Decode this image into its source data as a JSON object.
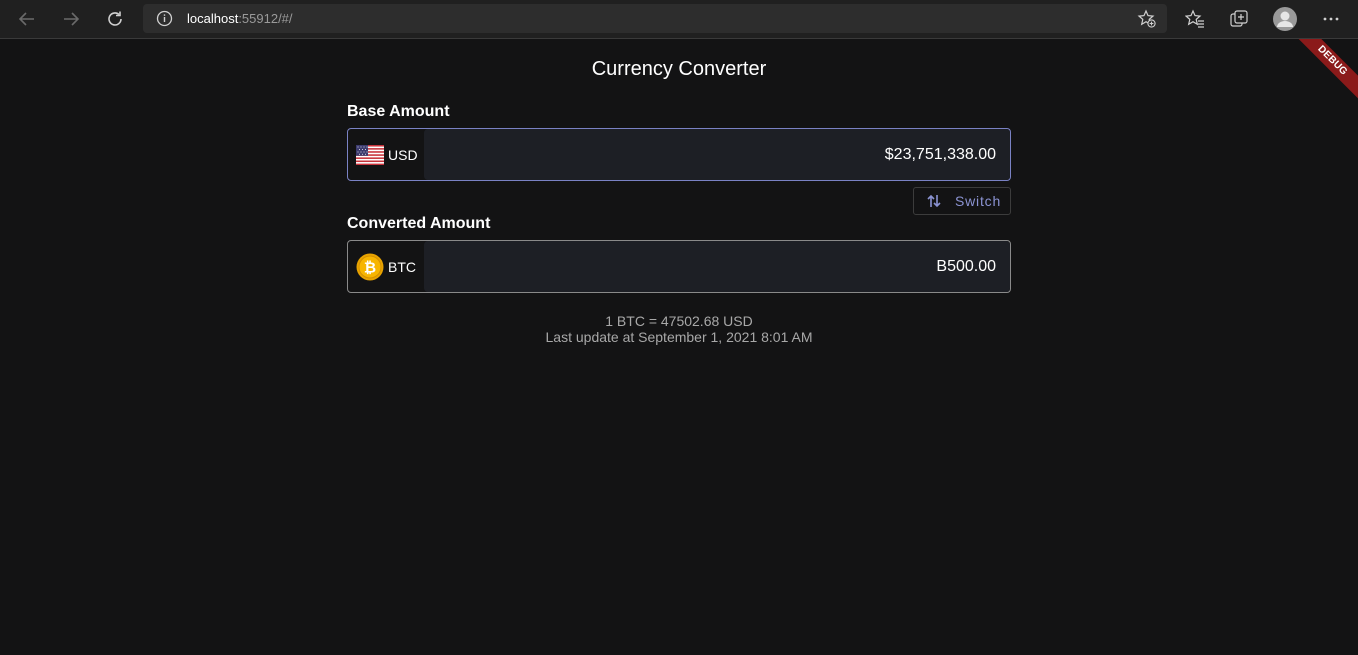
{
  "browser": {
    "url_host": "localhost",
    "url_rest": ":55912/#/"
  },
  "app": {
    "debug_label": "DEBUG",
    "title": "Currency Converter",
    "base": {
      "label": "Base Amount",
      "currency_code": "USD",
      "amount": "$23,751,338.00"
    },
    "switch_label": "Switch",
    "converted": {
      "label": "Converted Amount",
      "currency_code": "BTC",
      "amount": "B500.00"
    },
    "rate_line": "1 BTC = 47502.68 USD",
    "update_line": "Last update at September 1, 2021 8:01 AM"
  },
  "colors": {
    "background": "#131314",
    "accent": "#7a82c4",
    "field_fill": "#1d1f25",
    "debug_banner": "#8b1a1a"
  },
  "icons": {
    "back": "arrow-left-icon",
    "forward": "arrow-right-icon",
    "refresh": "refresh-icon",
    "site_info": "info-icon",
    "add_favorite": "star-add-icon",
    "favorites": "favorites-icon",
    "collections": "collections-icon",
    "profile": "profile-avatar-icon",
    "menu": "more-dots-icon",
    "switch": "swap-vertical-icon",
    "usd_flag": "us-flag-icon",
    "btc_coin": "bitcoin-icon"
  }
}
